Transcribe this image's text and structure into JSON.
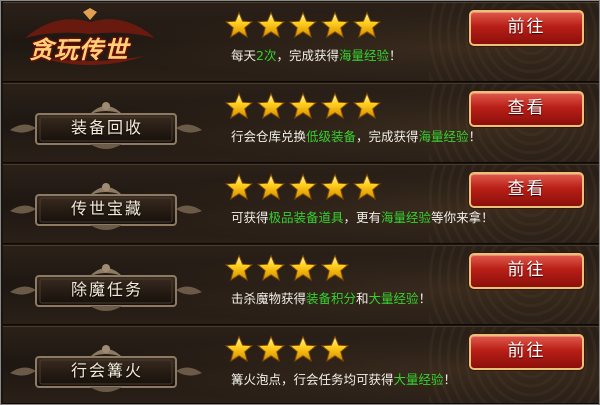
{
  "logo": {
    "text": "贪玩传世"
  },
  "rows": [
    {
      "name": "",
      "stars": 5,
      "desc": [
        {
          "t": "每天",
          "hl": false
        },
        {
          "t": "2次",
          "hl": true
        },
        {
          "t": "，完成获得",
          "hl": false
        },
        {
          "t": "海量经验",
          "hl": true
        },
        {
          "t": "！",
          "hl": false
        }
      ],
      "button": "前往"
    },
    {
      "name": "装备回收",
      "stars": 5,
      "desc": [
        {
          "t": "行会仓库兑换",
          "hl": false
        },
        {
          "t": "低级装备",
          "hl": true
        },
        {
          "t": "，完成获得",
          "hl": false
        },
        {
          "t": "海量经验",
          "hl": true
        },
        {
          "t": "！",
          "hl": false
        }
      ],
      "button": "查看"
    },
    {
      "name": "传世宝藏",
      "stars": 5,
      "desc": [
        {
          "t": "可获得",
          "hl": false
        },
        {
          "t": "极品装备道具",
          "hl": true
        },
        {
          "t": "，更有",
          "hl": false
        },
        {
          "t": "海量经验",
          "hl": true
        },
        {
          "t": "等你来拿！",
          "hl": false
        }
      ],
      "button": "查看"
    },
    {
      "name": "除魔任务",
      "stars": 4,
      "desc": [
        {
          "t": "击杀魔物获得",
          "hl": false
        },
        {
          "t": "装备积分",
          "hl": true
        },
        {
          "t": "和",
          "hl": false
        },
        {
          "t": "大量经验",
          "hl": true
        },
        {
          "t": "！",
          "hl": false
        }
      ],
      "button": "前往"
    },
    {
      "name": "行会篝火",
      "stars": 4,
      "desc": [
        {
          "t": "篝火泡点，行会任务均可获得",
          "hl": false
        },
        {
          "t": "大量经验",
          "hl": true
        },
        {
          "t": "！",
          "hl": false
        }
      ],
      "button": "前往"
    }
  ],
  "colors": {
    "highlight": "#35d12f",
    "star": "#ffcc1a",
    "button": "#b81f17"
  },
  "icons": {
    "star": "star-icon",
    "plaque": "ornate-plaque"
  }
}
